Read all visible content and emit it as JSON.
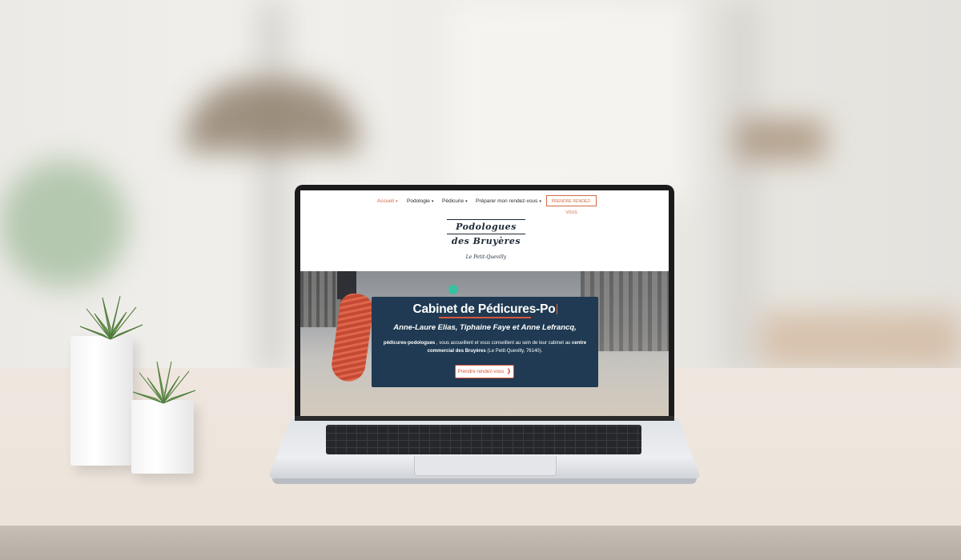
{
  "site": {
    "nav": {
      "items": [
        {
          "label": "Accueil",
          "has_dropdown": true,
          "active": true
        },
        {
          "label": "Podologie",
          "has_dropdown": true,
          "active": false
        },
        {
          "label": "Pédicurie",
          "has_dropdown": true,
          "active": false
        },
        {
          "label": "Préparer mon rendez-vous",
          "has_dropdown": true,
          "active": false
        }
      ],
      "cta_label": "PRENDRE RENDEZ-VOUS",
      "caret_icon": "chevron-down-icon"
    },
    "logo": {
      "line1": "Podologues",
      "line2": "des Bruyères",
      "subtitle": "Le Petit-Quevilly"
    },
    "hero": {
      "title": "Cabinet de Pédicures-Po",
      "names": "Anne-Laure Elias, Tiphaine Faye et Anne Lefrancq,",
      "body_bold1": "pédicures-podologues",
      "body_text1": " , vous accueillent et vous conseillent au sein de leur cabinet au ",
      "body_bold2": "centre commercial des Bruyères",
      "body_text2": " (Le Petit-Quevilly, 76140).",
      "button_label": "Prendre rendez-vous",
      "button_icon": "footprint-icon"
    }
  },
  "colors": {
    "accent": "#d06a45",
    "card_bg": "#1f3a52",
    "logo": "#1d2a36"
  }
}
